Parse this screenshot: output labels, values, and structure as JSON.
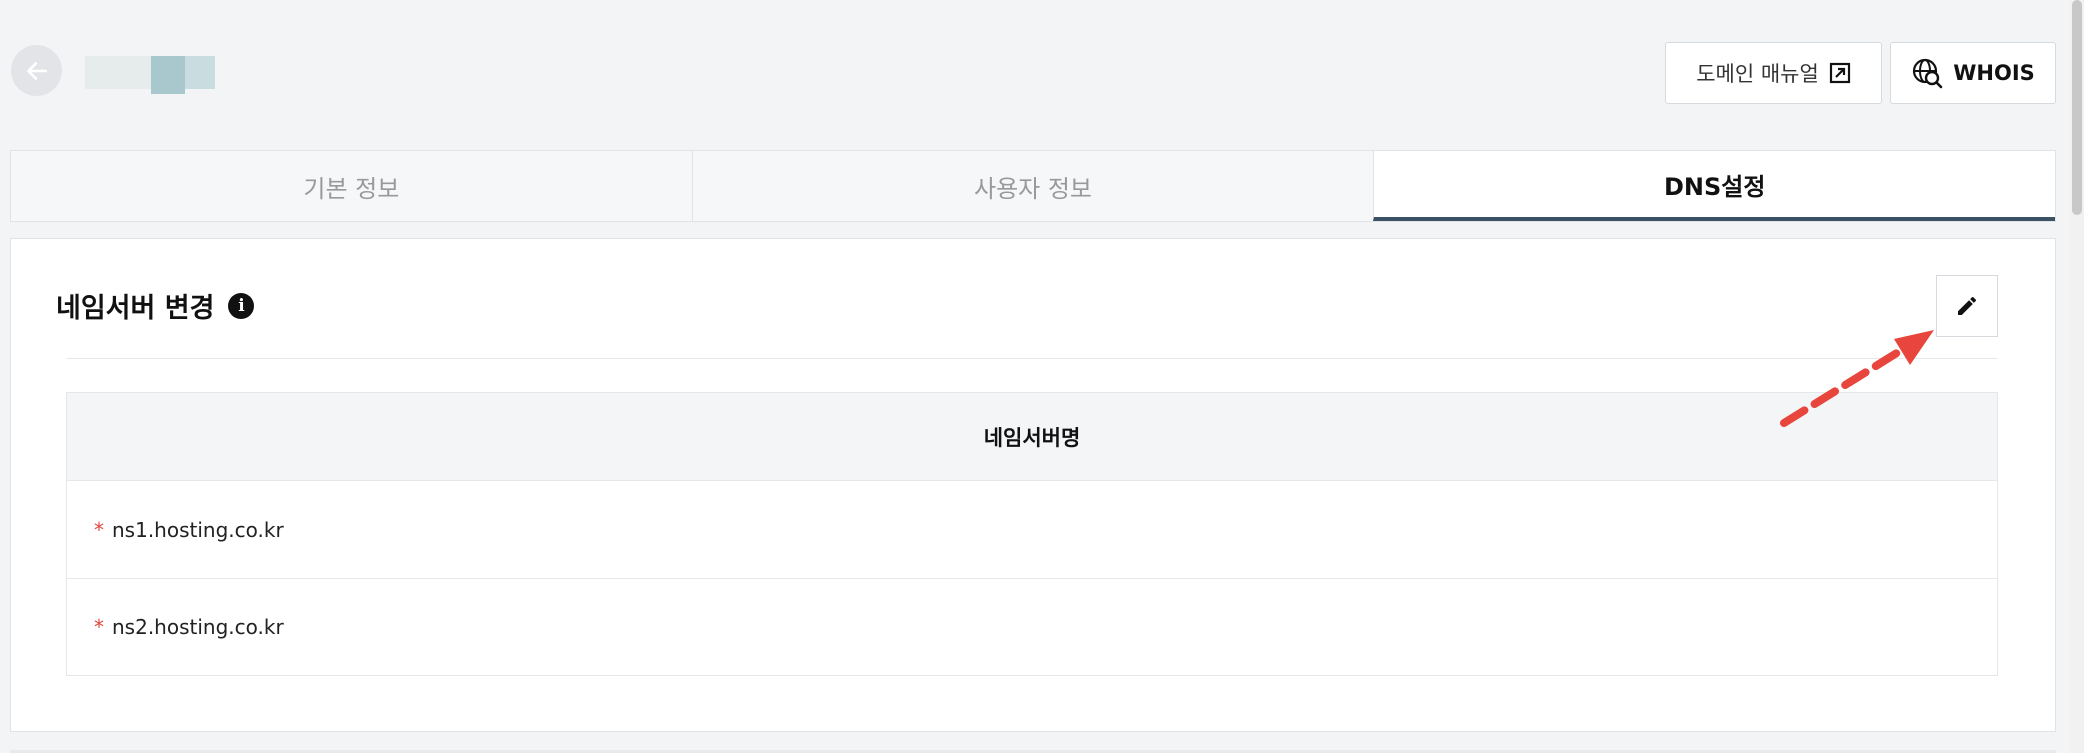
{
  "header": {
    "back_icon": "arrow-left-icon",
    "manual_label": "도메인 매뉴얼",
    "manual_icon": "external-link-icon",
    "whois_label": "WHOIS",
    "whois_icon": "globe-search-icon"
  },
  "tabs": [
    {
      "label": "기본 정보",
      "active": false
    },
    {
      "label": "사용자 정보",
      "active": false
    },
    {
      "label": "DNS설정",
      "active": true
    }
  ],
  "section": {
    "title": "네임서버 변경",
    "info_icon": "info-icon",
    "edit_icon": "pencil-icon"
  },
  "nameserver_table": {
    "header": "네임서버명",
    "required_mark": "*",
    "rows": [
      "ns1.hosting.co.kr",
      "ns2.hosting.co.kr"
    ]
  },
  "colors": {
    "active_tab_underline": "#3b5266",
    "required_mark": "#e0463c",
    "annotation_arrow": "#e8453c"
  }
}
